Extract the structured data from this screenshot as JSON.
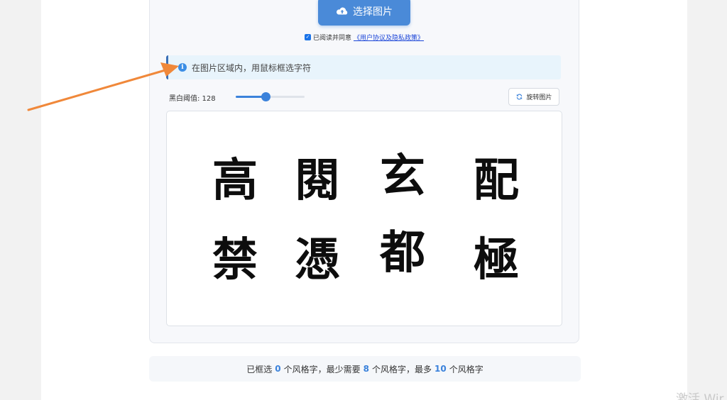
{
  "upload": {
    "label": "选择图片"
  },
  "agreement": {
    "checked": true,
    "prefix": "已阅读并同意",
    "link": "《用户协议及隐私政策》"
  },
  "info": {
    "text": "在图片区域内，用鼠标框选字符"
  },
  "threshold": {
    "label": "黑白阈值: 128",
    "value": 128,
    "max": 255
  },
  "rotate": {
    "label": "旋转图片"
  },
  "image": {
    "characters": [
      "高",
      "閱",
      "玄",
      "配",
      "禁",
      "憑",
      "都",
      "極"
    ]
  },
  "status": {
    "p1": "已框选",
    "selected": "0",
    "p2": "个风格字，最少需要",
    "min": "8",
    "p3": "个风格字，最多",
    "max": "10",
    "p4": "个风格字"
  },
  "watermark": "激活 Wir",
  "colors": {
    "accent": "#3b82db",
    "arrow": "#f0883a",
    "info_bg": "#e8f4fc"
  },
  "icons": {
    "upload": "cloud-upload-icon",
    "info": "info-icon",
    "rotate": "refresh-icon"
  }
}
